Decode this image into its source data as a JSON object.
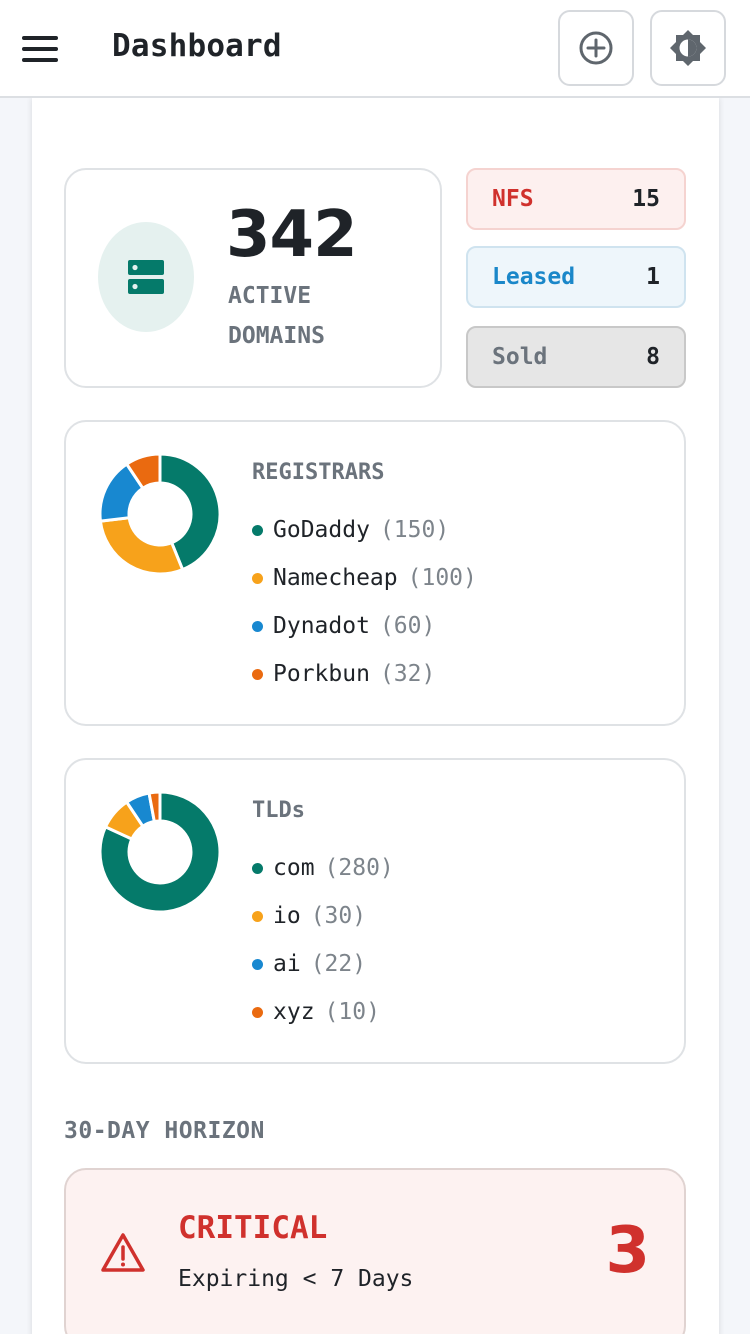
{
  "header": {
    "title": "Dashboard",
    "menu_icon": "hamburger-menu-icon",
    "add_icon": "plus-circle-icon",
    "theme_icon": "brightness-icon"
  },
  "summary": {
    "active_count": "342",
    "active_label": "ACTIVE DOMAINS",
    "icon": "server-icon",
    "statuses": [
      {
        "label": "NFS",
        "count": "15",
        "color": "#d0312d"
      },
      {
        "label": "Leased",
        "count": "1",
        "color": "#1a87c9"
      },
      {
        "label": "Sold",
        "count": "8",
        "color": "#6b737c"
      }
    ]
  },
  "chart_data": [
    {
      "type": "pie",
      "title": "REGISTRARS",
      "categories": [
        "GoDaddy",
        "Namecheap",
        "Dynadot",
        "Porkbun"
      ],
      "values": [
        150,
        100,
        60,
        32
      ],
      "colors": [
        "#057a6a",
        "#f7a21b",
        "#1888d0",
        "#ea6a10"
      ]
    },
    {
      "type": "pie",
      "title": "TLDs",
      "categories": [
        "com",
        "io",
        "ai",
        "xyz"
      ],
      "values": [
        280,
        30,
        22,
        10
      ],
      "colors": [
        "#057a6a",
        "#f7a21b",
        "#1888d0",
        "#ea6a10"
      ]
    }
  ],
  "horizon": {
    "heading": "30-DAY HORIZON",
    "critical": {
      "title": "CRITICAL",
      "subtitle": "Expiring < 7 Days",
      "count": "3",
      "icon": "warning-triangle-icon",
      "color": "#d0312d"
    }
  }
}
